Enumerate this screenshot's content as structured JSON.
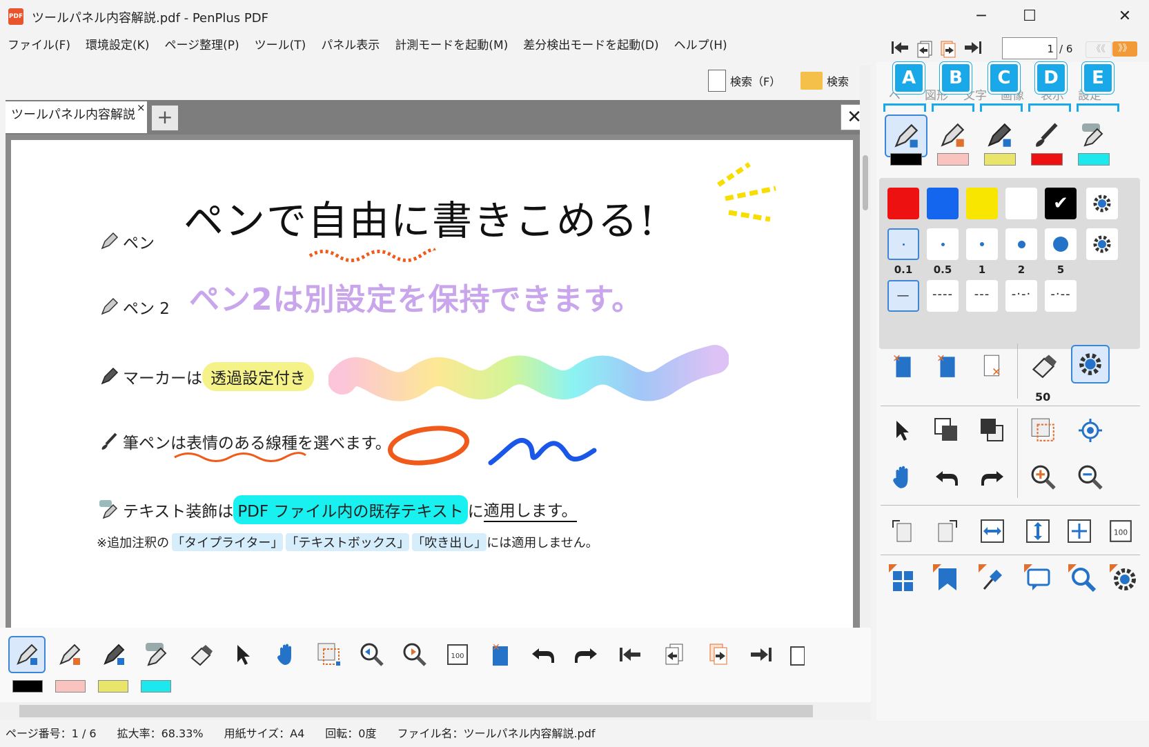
{
  "window": {
    "title": "ツールパネル内容解説.pdf - PenPlus PDF",
    "app_icon_text": "PDF",
    "minimize": "─",
    "maximize": "☐",
    "close": "✕"
  },
  "menu": [
    "ファイル(F)",
    "環境設定(K)",
    "ページ整理(P)",
    "ツール(T)",
    "パネル表示",
    "計測モードを起動(M)",
    "差分検出モードを起動(D)",
    "ヘルプ(H)"
  ],
  "nav": {
    "current_page": "1",
    "total": "/ 6",
    "rew": "《《",
    "ff": "》》"
  },
  "search": {
    "search_f": "検索（F）",
    "search_folder": "検索"
  },
  "tabs": {
    "doc_tab": "ツールパネル内容解説",
    "close": "×",
    "add": "+",
    "doc_close": "✕"
  },
  "document": {
    "pen_label": "ペン",
    "pen_handwriting": "ペンで自由に書きこめる!",
    "pen2_label": "ペン 2",
    "pen2_handwriting": "ペン2は別設定を保持できます。",
    "marker_prefix": "マーカーは",
    "marker_highlight": "透過設定付き",
    "brush_prefix": "筆ペンは",
    "brush_text": "表情のある線種を選べます。",
    "text_prefix": "テキスト装飾は",
    "text_highlight": "PDF ファイル内の既存テキスト",
    "text_suffix": "に",
    "text_underline": "適用します。",
    "note_prefix": "※追加注釈の",
    "note_typewriter": "「タイプライター」",
    "note_textbox": "「テキストボックス」",
    "note_callout": "「吹き出し」",
    "note_suffix": "には適用しません。"
  },
  "status": {
    "page": "ページ番号：1 / 6",
    "zoom": "拡大率：68.33%",
    "paper": "用紙サイズ：A4",
    "rotation": "回転：0度",
    "filename": "ファイル名：ツールパネル内容解説.pdf"
  },
  "right_panel": {
    "callouts": [
      "A",
      "B",
      "C",
      "D",
      "E"
    ],
    "tabs": [
      "ペ",
      "図形",
      "文字",
      "画像",
      "表示",
      "設定"
    ],
    "colors": {
      "pen": "#000000",
      "pen2": "#f9c4c0",
      "marker": "#e9e56a",
      "brush": "#ee1111",
      "text": "#1de8ee"
    },
    "palette": [
      "#ee1111",
      "#1466ee",
      "#f9e600",
      "#ffffff",
      "#000000"
    ],
    "sizes": [
      "0.1",
      "0.5",
      "1",
      "2",
      "5"
    ],
    "line_styles": [
      "—",
      "----",
      "---",
      "-·-·",
      "-·--"
    ],
    "eraser_size": "50"
  }
}
